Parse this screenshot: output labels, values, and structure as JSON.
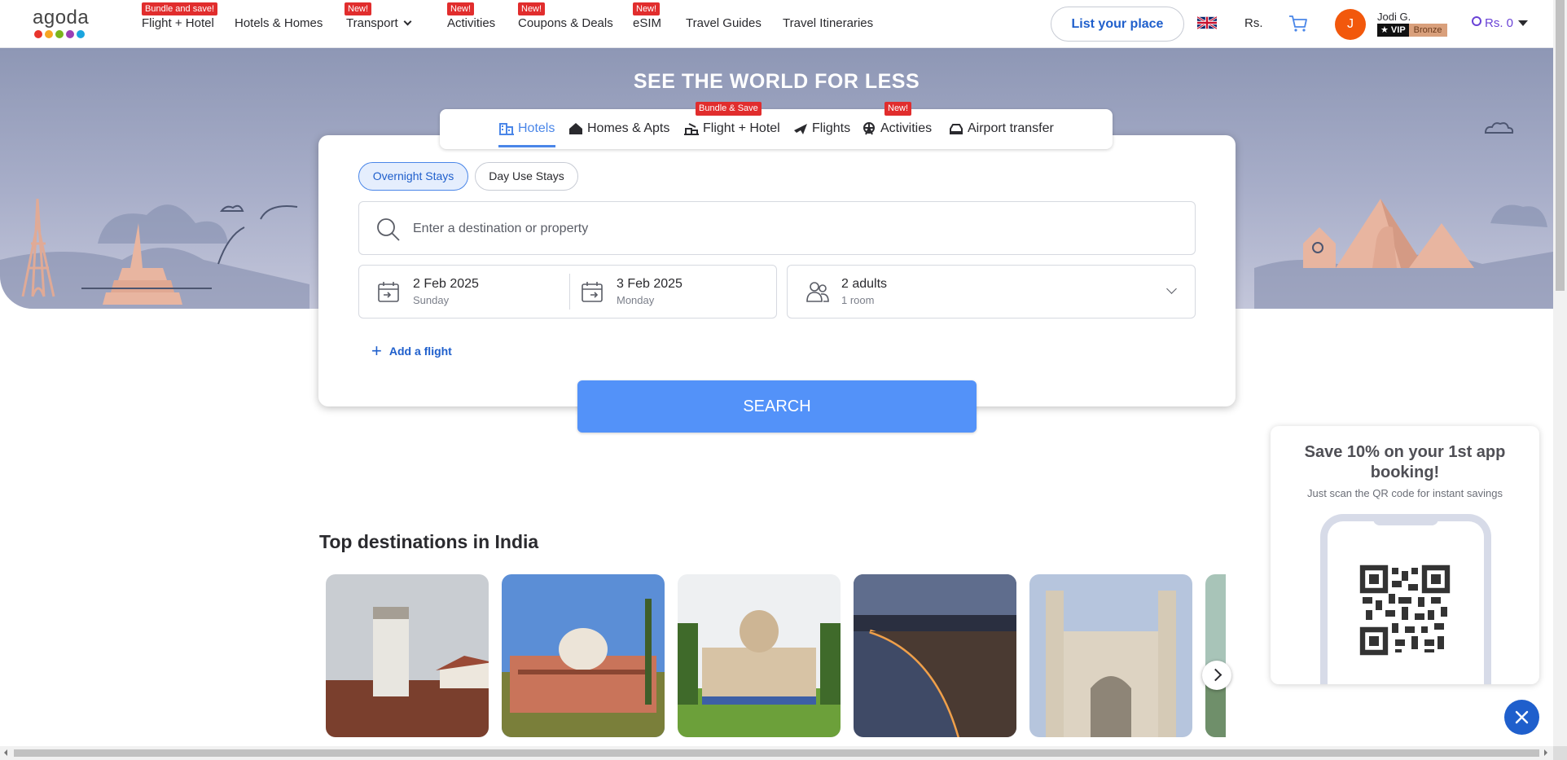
{
  "brand": {
    "logo_text": "agoda",
    "dot_colors": [
      "#e8342c",
      "#f6a623",
      "#7ab51d",
      "#9b3fb5",
      "#1aa5df"
    ]
  },
  "nav": {
    "items": [
      {
        "label": "Flight + Hotel",
        "badge": "Bundle and save!"
      },
      {
        "label": "Hotels & Homes",
        "badge": ""
      },
      {
        "label": "Transport",
        "badge": "New!"
      },
      {
        "label": "Activities",
        "badge": "New!"
      },
      {
        "label": "Coupons & Deals",
        "badge": "New!"
      },
      {
        "label": "eSIM",
        "badge": "New!"
      },
      {
        "label": "Travel Guides",
        "badge": ""
      },
      {
        "label": "Travel Itineraries",
        "badge": ""
      }
    ],
    "list_your_place": "List your place",
    "currency": "Rs.",
    "user": {
      "initial": "J",
      "name": "Jodi G.",
      "vip": "VIP",
      "tier": "Bronze"
    },
    "rewards": "Rs. 0"
  },
  "hero": {
    "title": "SEE THE WORLD FOR LESS"
  },
  "tabs": [
    {
      "label": "Hotels",
      "badge": ""
    },
    {
      "label": "Homes & Apts",
      "badge": ""
    },
    {
      "label": "Flight + Hotel",
      "badge": "Bundle & Save"
    },
    {
      "label": "Flights",
      "badge": ""
    },
    {
      "label": "Activities",
      "badge": "New!"
    },
    {
      "label": "Airport transfer",
      "badge": ""
    }
  ],
  "search": {
    "stay_types": [
      "Overnight Stays",
      "Day Use Stays"
    ],
    "destination_placeholder": "Enter a destination or property",
    "check_in": {
      "date": "2 Feb 2025",
      "day": "Sunday"
    },
    "check_out": {
      "date": "3 Feb 2025",
      "day": "Monday"
    },
    "guests": {
      "adults": "2 adults",
      "rooms": "1 room"
    },
    "add_flight": "Add a flight",
    "button": "SEARCH"
  },
  "destinations": {
    "title": "Top destinations in India"
  },
  "promo": {
    "title": "Save 10% on your 1st app booking!",
    "subtitle": "Just scan the QR code for instant savings"
  },
  "colors": {
    "accent": "#5392f9",
    "link": "#1f5fcc",
    "badge": "#e12d2d"
  }
}
